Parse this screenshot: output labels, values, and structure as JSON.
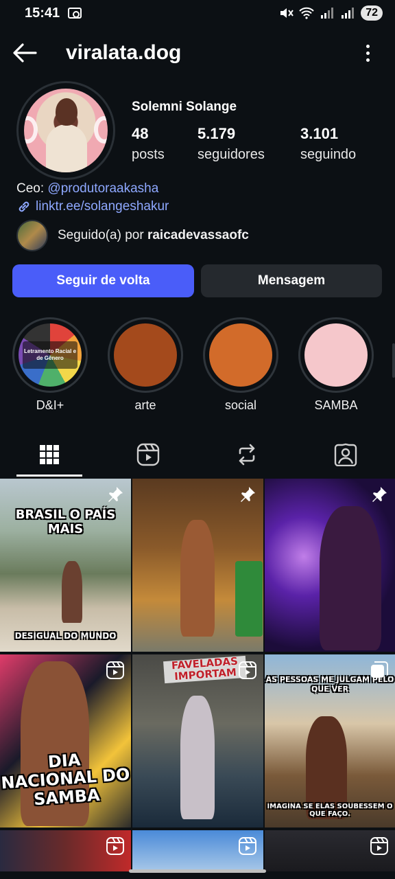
{
  "status_bar": {
    "time": "15:41",
    "battery": "72"
  },
  "header": {
    "username": "viralata.dog"
  },
  "profile": {
    "full_name": "Solemni Solange",
    "stats": [
      {
        "value": "48",
        "label": "posts"
      },
      {
        "value": "5.179",
        "label": "seguidores"
      },
      {
        "value": "3.101",
        "label": "seguindo"
      }
    ],
    "bio_prefix": "Ceo: ",
    "bio_mention": "@produtoraakasha",
    "link": "linktr.ee/solangeshakur",
    "followed_prefix": "Seguido(a) por ",
    "followed_user": "raicadevassaofc"
  },
  "buttons": {
    "follow": "Seguir de volta",
    "message": "Mensagem"
  },
  "highlights": [
    {
      "label": "D&I+",
      "cover_text": "Letramento Racial e de Gênero",
      "color": "#e0433b"
    },
    {
      "label": "arte",
      "color": "#a44a1c"
    },
    {
      "label": "social",
      "color": "#d26b2a"
    },
    {
      "label": "SAMBA",
      "color": "#f5c7cb"
    }
  ],
  "tabs": [
    "grid-icon",
    "reels-icon",
    "reposts-icon",
    "tagged-icon"
  ],
  "posts": [
    {
      "type": "pinned",
      "text_top": "BRASIL O PAÍS MAIS",
      "text_bottom": "DESIGUAL DO MUNDO"
    },
    {
      "type": "pinned"
    },
    {
      "type": "pinned"
    },
    {
      "type": "reel",
      "text": "DIA NACIONAL DO SAMBA"
    },
    {
      "type": "reel",
      "text": "FAVELADAS IMPORTAM"
    },
    {
      "type": "carousel",
      "text_top": "AS PESSOAS ME JULGAM PELO QUE VER",
      "text_bottom": "IMAGINA SE ELAS SOUBESSEM O QUE FAÇO."
    },
    {
      "type": "reel"
    },
    {
      "type": "reel"
    },
    {
      "type": "reel"
    }
  ]
}
